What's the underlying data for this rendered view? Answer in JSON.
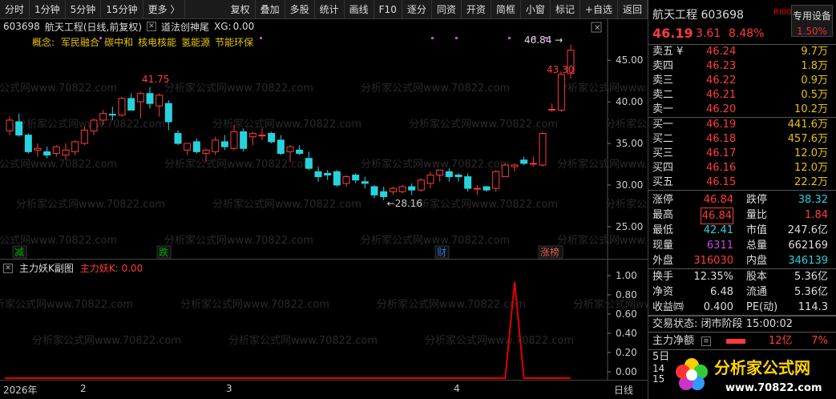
{
  "toolbar": {
    "items": [
      "分时",
      "1分钟",
      "5分钟",
      "15分钟",
      "更多 〉"
    ],
    "right_items": [
      "复权",
      "叠加",
      "多股",
      "统计",
      "画线",
      "F10",
      "逐分",
      "同资",
      "开资",
      "简框",
      "小窗",
      "标记",
      "+自选",
      "返回"
    ]
  },
  "info": {
    "code": "603698",
    "name": "航天工程",
    "mode": "(日线,前复权)",
    "indicator": "道法创神尾",
    "xg_label": "XG:",
    "xg_value": "0.00"
  },
  "concept": {
    "label": "概念:",
    "tags": [
      "军民融合",
      "碳中和",
      "核电核能",
      "氢能源",
      "节能环保"
    ]
  },
  "annotations": {
    "high_label": "41.75",
    "low_label": "←28.16",
    "peak_label": "46.84",
    "peak_arrow": "46.84 →",
    "close_label": "43.30"
  },
  "event_marks": [
    {
      "text": "减",
      "color": "#00aa00"
    },
    {
      "text": "跌",
      "color": "#00aa00"
    },
    {
      "text": "财",
      "color": "#2a6fdb"
    },
    {
      "text": "涨榜",
      "color": "#e06050"
    }
  ],
  "subchart": {
    "title": "主力妖K副图",
    "value_label": "主力妖K: 0.00",
    "ticks": [
      "1.00",
      "0.80",
      "0.60",
      "0.40",
      "0.20",
      "0.00"
    ]
  },
  "xaxis": {
    "labels": [
      "2026年",
      "2",
      "3",
      "4",
      "日线"
    ]
  },
  "chart_data": {
    "type": "candlestick",
    "ylim": [
      22,
      48
    ],
    "yticks": [
      "45.00",
      "40.00",
      "35.00",
      "30.00",
      "25.00"
    ],
    "candles": [
      [
        36.5,
        38.2,
        36.0,
        37.8
      ],
      [
        37.6,
        38.6,
        35.8,
        36.0
      ],
      [
        36.0,
        36.2,
        33.8,
        34.0
      ],
      [
        34.2,
        35.0,
        33.4,
        34.4
      ],
      [
        34.0,
        34.6,
        33.2,
        33.6
      ],
      [
        33.8,
        34.8,
        33.4,
        34.6
      ],
      [
        33.6,
        35.0,
        33.0,
        34.2
      ],
      [
        34.0,
        35.4,
        33.6,
        35.2
      ],
      [
        35.0,
        37.0,
        34.8,
        36.6
      ],
      [
        36.5,
        38.0,
        36.0,
        37.8
      ],
      [
        37.8,
        39.0,
        37.2,
        38.6
      ],
      [
        38.5,
        39.4,
        37.8,
        38.4
      ],
      [
        38.4,
        40.6,
        38.2,
        40.4
      ],
      [
        40.4,
        41.0,
        39.0,
        39.0
      ],
      [
        40.0,
        41.2,
        38.0,
        41.0
      ],
      [
        41.0,
        41.75,
        39.2,
        39.8
      ],
      [
        39.5,
        41.0,
        38.2,
        40.8
      ],
      [
        39.8,
        40.2,
        36.6,
        37.6
      ],
      [
        36.2,
        36.6,
        34.8,
        35.0
      ],
      [
        34.2,
        35.0,
        33.6,
        35.0
      ],
      [
        35.2,
        35.6,
        33.8,
        34.0
      ],
      [
        33.8,
        34.4,
        32.8,
        34.2
      ],
      [
        34.0,
        35.8,
        33.6,
        35.4
      ],
      [
        35.2,
        36.0,
        34.2,
        34.6
      ],
      [
        34.4,
        37.2,
        34.2,
        36.4
      ],
      [
        36.4,
        36.8,
        34.0,
        34.4
      ],
      [
        35.8,
        36.4,
        34.8,
        36.2
      ],
      [
        36.0,
        36.8,
        35.4,
        36.0
      ],
      [
        36.2,
        36.4,
        35.0,
        35.2
      ],
      [
        35.4,
        36.0,
        33.6,
        33.8
      ],
      [
        34.0,
        34.8,
        32.8,
        34.6
      ],
      [
        34.2,
        34.8,
        33.6,
        33.8
      ],
      [
        33.2,
        34.0,
        31.8,
        32.0
      ],
      [
        31.6,
        32.2,
        30.4,
        31.0
      ],
      [
        31.4,
        31.8,
        30.6,
        31.2
      ],
      [
        31.6,
        31.8,
        29.8,
        30.0
      ],
      [
        30.2,
        31.2,
        29.8,
        31.0
      ],
      [
        31.2,
        31.4,
        30.2,
        30.6
      ],
      [
        30.4,
        31.0,
        29.6,
        30.2
      ],
      [
        29.8,
        30.0,
        28.4,
        28.8
      ],
      [
        29.2,
        29.8,
        28.16,
        28.6
      ],
      [
        29.2,
        29.8,
        28.8,
        29.6
      ],
      [
        29.2,
        30.0,
        29.0,
        29.8
      ],
      [
        29.8,
        30.2,
        28.8,
        29.4
      ],
      [
        29.4,
        30.8,
        29.2,
        30.6
      ],
      [
        30.2,
        31.6,
        29.6,
        31.2
      ],
      [
        31.2,
        31.8,
        30.4,
        31.8
      ],
      [
        31.6,
        32.0,
        30.4,
        31.0
      ],
      [
        31.2,
        31.4,
        30.4,
        31.0
      ],
      [
        31.0,
        31.4,
        29.2,
        29.6
      ],
      [
        29.6,
        30.0,
        28.8,
        29.6
      ],
      [
        29.8,
        29.8,
        29.2,
        29.4
      ],
      [
        29.6,
        31.8,
        29.2,
        31.6
      ],
      [
        31.0,
        32.6,
        31.2,
        32.4
      ],
      [
        32.2,
        32.6,
        31.6,
        32.4
      ],
      [
        33.0,
        33.4,
        32.4,
        32.6
      ],
      [
        32.6,
        33.4,
        32.2,
        32.6
      ],
      [
        32.4,
        36.4,
        32.2,
        36.2
      ],
      [
        39.1,
        39.8,
        38.8,
        39.1
      ],
      [
        39.0,
        43.5,
        38.8,
        43.3
      ],
      [
        43.4,
        46.84,
        42.8,
        46.19
      ]
    ]
  },
  "subchart_data": {
    "type": "line",
    "values": [
      0,
      0,
      0,
      0,
      0,
      0,
      0,
      0,
      0,
      0,
      0,
      0,
      0,
      0,
      0,
      0,
      0,
      0,
      0,
      0,
      0,
      0,
      0,
      0,
      0,
      0,
      0,
      0,
      0,
      0,
      0,
      0,
      0,
      0,
      0,
      0,
      0,
      0,
      0,
      0,
      0,
      0,
      0,
      0,
      0,
      0,
      0,
      0,
      0,
      0,
      0,
      0,
      0,
      0,
      1,
      0,
      0,
      0,
      0,
      0,
      0
    ],
    "ylim": [
      0,
      1
    ]
  },
  "quote": {
    "name": "航天工程",
    "code": "603698",
    "logo": "RI000",
    "special_btn": "专用设备",
    "special_pct": "1.50%",
    "price": "46.19",
    "chg": "3.61",
    "pct": "8.48%"
  },
  "orderbook": {
    "asks": [
      {
        "k": "卖五 ¥",
        "p": "46.24",
        "v": "9.7万"
      },
      {
        "k": "卖四",
        "p": "46.23",
        "v": "1.8万"
      },
      {
        "k": "卖三",
        "p": "46.22",
        "v": "0.9万"
      },
      {
        "k": "卖二",
        "p": "46.21",
        "v": "0.5万"
      },
      {
        "k": "卖一",
        "p": "46.20",
        "v": "10.2万"
      }
    ],
    "bids": [
      {
        "k": "买一",
        "p": "46.19",
        "v": "441.6万"
      },
      {
        "k": "买二",
        "p": "46.18",
        "v": "457.6万"
      },
      {
        "k": "买三",
        "p": "46.17",
        "v": "12.0万"
      },
      {
        "k": "买四",
        "p": "46.16",
        "v": "12.0万"
      },
      {
        "k": "买五",
        "p": "46.15",
        "v": "22.2万"
      }
    ]
  },
  "stats1": [
    {
      "a": "涨停",
      "b": "46.84",
      "bc": "red",
      "c": "跌停",
      "d": "38.32",
      "dc": "cyan"
    },
    {
      "a": "最高",
      "b": "46.84",
      "bc": "red boxed",
      "c": "量比",
      "d": "1.84",
      "dc": "red"
    },
    {
      "a": "最低",
      "b": "42.41",
      "bc": "cyan",
      "c": "市值",
      "d": "247.6亿",
      "dc": "wh"
    },
    {
      "a": "现量",
      "b": "6311",
      "bc": "pur",
      "c": "总量",
      "d": "662169",
      "dc": "wh"
    },
    {
      "a": "外盘",
      "b": "316030",
      "bc": "red",
      "c": "内盘",
      "d": "346139",
      "dc": "cyan"
    }
  ],
  "stats2": [
    {
      "a": "换手",
      "b": "12.35%",
      "bc": "wh",
      "c": "股本",
      "d": "5.36亿",
      "dc": "wh"
    },
    {
      "a": "净资",
      "b": "6.48",
      "bc": "wh",
      "c": "流通",
      "d": "5.36亿",
      "dc": "wh"
    },
    {
      "a": "收益㈣",
      "b": "0.400",
      "bc": "wh",
      "c": "PE(动)",
      "d": "114.3",
      "dc": "wh"
    }
  ],
  "trade": {
    "label": "交易状态:",
    "status": "闭市阶段",
    "time": "15:00:02"
  },
  "net": {
    "label": "主力净额",
    "value": "12亿",
    "pct": "7%"
  },
  "footer_text": "5日",
  "footer_nums": [
    "14",
    "15"
  ],
  "watermark": {
    "cn": "分析家公式网",
    "url": "www.70822.com",
    "repeat": "分析家公式网www.70822.com"
  }
}
